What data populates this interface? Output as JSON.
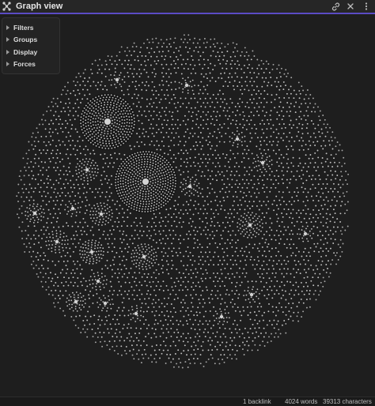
{
  "header": {
    "title": "Graph view",
    "icon": "graph-icon",
    "accent_color": "#5b4bc4",
    "actions": [
      {
        "name": "link-icon"
      },
      {
        "name": "close-icon"
      },
      {
        "name": "more-options-icon"
      }
    ]
  },
  "controls": {
    "items": [
      {
        "label": "Filters"
      },
      {
        "label": "Groups"
      },
      {
        "label": "Display"
      },
      {
        "label": "Forces"
      }
    ]
  },
  "status": {
    "backlinks": "1 backlink",
    "words": "4024 words",
    "characters": "39313 characters"
  },
  "graph": {
    "node_color": "#d4d4d4",
    "link_color": "#555555",
    "background": "#1e1e1e"
  }
}
